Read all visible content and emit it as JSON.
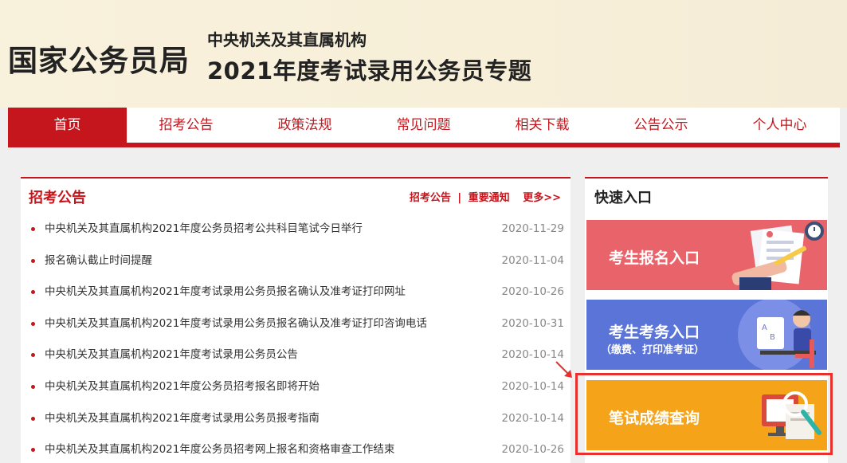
{
  "header": {
    "brand": "国家公务员局",
    "subtitle_line1": "中央机关及其直属机构",
    "subtitle_line2": "2021年度考试录用公务员专题"
  },
  "nav": {
    "items": [
      {
        "label": "首页",
        "active": true
      },
      {
        "label": "招考公告",
        "active": false
      },
      {
        "label": "政策法规",
        "active": false
      },
      {
        "label": "常见问题",
        "active": false
      },
      {
        "label": "相关下载",
        "active": false
      },
      {
        "label": "公告公示",
        "active": false
      },
      {
        "label": "个人中心",
        "active": false
      }
    ]
  },
  "announcements": {
    "title": "招考公告",
    "link1": "招考公告",
    "separator": "|",
    "link2": "重要通知",
    "more": "更多>>",
    "items": [
      {
        "title": "中央机关及其直属机构2021年度公务员招考公共科目笔试今日举行",
        "date": "2020-11-29"
      },
      {
        "title": "报名确认截止时间提醒",
        "date": "2020-11-04"
      },
      {
        "title": "中央机关及其直属机构2021年度考试录用公务员报名确认及准考证打印网址",
        "date": "2020-10-26"
      },
      {
        "title": "中央机关及其直属机构2021年度考试录用公务员报名确认及准考证打印咨询电话",
        "date": "2020-10-31"
      },
      {
        "title": "中央机关及其直属机构2021年度考试录用公务员公告",
        "date": "2020-10-14"
      },
      {
        "title": "中央机关及其直属机构2021年度公务员招考报名即将开始",
        "date": "2020-10-14"
      },
      {
        "title": "中央机关及其直属机构2021年度考试录用公务员报考指南",
        "date": "2020-10-14"
      },
      {
        "title": "中央机关及其直属机构2021年度公务员招考网上报名和资格审查工作结束",
        "date": "2020-10-26"
      }
    ]
  },
  "quick": {
    "title": "快速入口",
    "card1": "考生报名入口",
    "card2": "考生考务入口",
    "card2_sub": "（缴费、打印准考证）",
    "card3": "笔试成绩查询"
  },
  "colors": {
    "brand_red": "#c4161c",
    "card_red": "#e8636a",
    "card_blue": "#5b74d8",
    "card_orange": "#f5a319",
    "highlight": "#e8302c"
  }
}
